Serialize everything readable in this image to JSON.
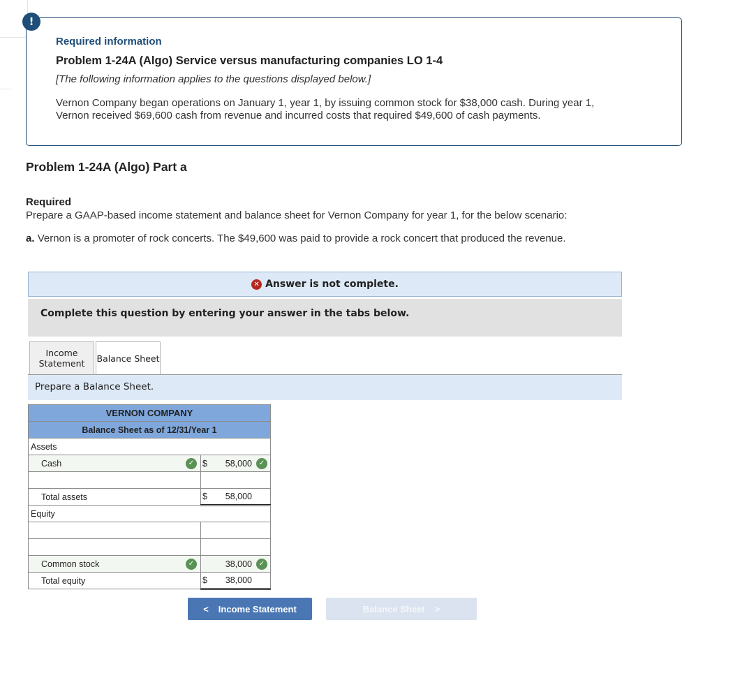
{
  "info": {
    "badge": "!",
    "label": "Required information",
    "title": "Problem 1-24A (Algo) Service versus manufacturing companies LO 1-4",
    "note": "[The following information applies to the questions displayed below.]",
    "body": "Vernon Company began operations on January 1, year 1, by issuing common stock for $38,000 cash. During year 1, Vernon received $69,600 cash from revenue and incurred costs that required $49,600 of cash payments."
  },
  "part": {
    "title": "Problem 1-24A (Algo) Part a",
    "required_label": "Required",
    "required_text": "Prepare a GAAP-based income statement and balance sheet for Vernon Company for year 1, for the below scenario:",
    "scenario_prefix": "a.",
    "scenario_text": "Vernon is a promoter of rock concerts. The $49,600 was paid to provide a rock concert that produced the revenue."
  },
  "status": {
    "icon": "x-circle-icon",
    "text": "Answer is not complete.",
    "instruction": "Complete this question by entering your answer in the tabs below."
  },
  "tabs": [
    {
      "label_line1": "Income",
      "label_line2": "Statement",
      "active": false
    },
    {
      "label": "Balance Sheet",
      "active": true
    }
  ],
  "prompt": "Prepare a Balance Sheet.",
  "balance_sheet": {
    "company": "VERNON COMPANY",
    "subtitle": "Balance Sheet as of 12/31/Year 1",
    "assets_label": "Assets",
    "cash_label": "Cash",
    "cash_currency": "$",
    "cash_value": "58,000",
    "total_assets_label": "Total assets",
    "total_assets_currency": "$",
    "total_assets_value": "58,000",
    "equity_label": "Equity",
    "common_stock_label": "Common stock",
    "common_stock_value": "38,000",
    "total_equity_label": "Total equity",
    "total_equity_currency": "$",
    "total_equity_value": "38,000",
    "check_glyph": "✓"
  },
  "nav": {
    "prev_arrow": "<",
    "prev_label": "Income Statement",
    "next_label": "Balance Sheet",
    "next_arrow": ">"
  },
  "colors": {
    "accent": "#1f4e79",
    "header_fill": "#7fa7db",
    "correct": "#5a9154",
    "error": "#b5281f",
    "primary_button": "#4a77b4"
  }
}
